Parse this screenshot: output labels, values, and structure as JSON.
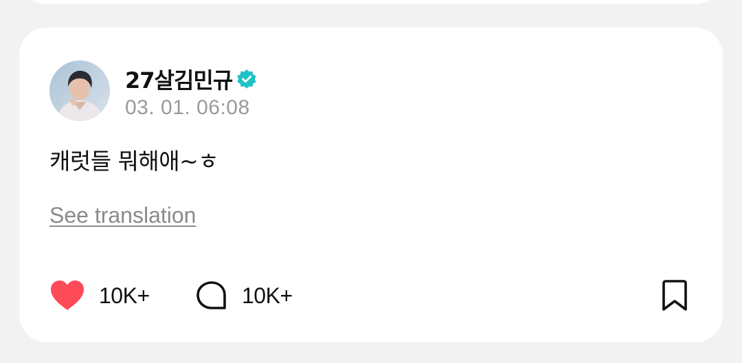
{
  "post": {
    "author": "27살김민규",
    "timestamp": "03. 01. 06:08",
    "text": "캐럿들 뭐해애~ㅎ",
    "translate_link": "See translation",
    "likes": "10K+",
    "comments": "10K+"
  },
  "icons": {
    "avatar": "user-avatar",
    "verified": "verified-badge-icon",
    "like": "heart-icon",
    "comment": "comment-bubble-icon",
    "bookmark": "bookmark-icon"
  },
  "colors": {
    "verified": "#1fc2c7",
    "like": "#ff4a57",
    "link": "#8a8a8a",
    "timestamp": "#9a9a9a"
  }
}
